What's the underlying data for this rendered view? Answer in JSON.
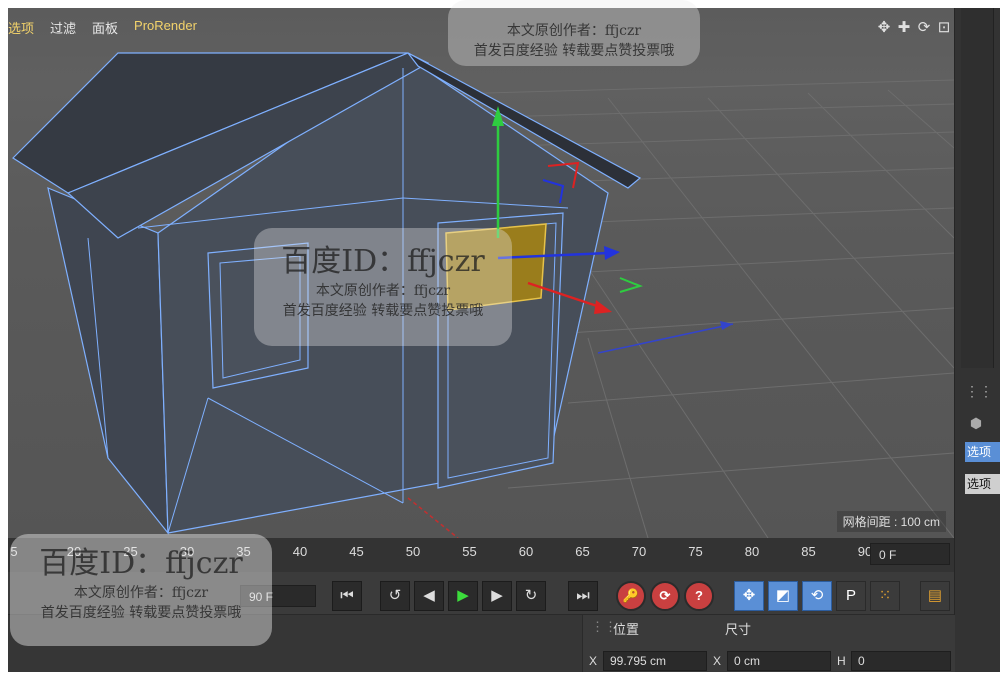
{
  "viewport": {
    "menu": [
      "选项",
      "过滤",
      "面板",
      "ProRender"
    ],
    "nav_icons": [
      "move-view-icon",
      "zoom-view-icon",
      "rotate-view-icon",
      "maximize-view-icon"
    ],
    "nav_glyphs": [
      "✥",
      "✚",
      "⟳",
      "⊡"
    ],
    "grid_spacing": "网格间距 : 100 cm"
  },
  "timeline": {
    "ticks": [
      "5",
      "20",
      "25",
      "30",
      "35",
      "40",
      "45",
      "50",
      "55",
      "60",
      "65",
      "70",
      "75",
      "80",
      "85",
      "90"
    ],
    "current_frame": "0 F"
  },
  "transport": {
    "end_frame": "90 F",
    "buttons": [
      {
        "name": "go-to-start-button",
        "glyph": "⏮"
      },
      {
        "name": "previous-key-button",
        "glyph": "↺"
      },
      {
        "name": "previous-frame-button",
        "glyph": "◀"
      },
      {
        "name": "play-button",
        "glyph": "▶"
      },
      {
        "name": "next-frame-button",
        "glyph": "▶"
      },
      {
        "name": "next-key-button",
        "glyph": "↻"
      },
      {
        "name": "go-to-end-button",
        "glyph": "⏭"
      }
    ],
    "record_buttons": [
      "🔑",
      "⟳",
      "?"
    ]
  },
  "coords": {
    "position_label": "位置",
    "size_label": "尺寸",
    "x_label": "X",
    "x_value": "99.795 cm",
    "x2_label": "X",
    "x2_value": "0 cm",
    "h_label": "H",
    "h_value": "0"
  },
  "right_strip": {
    "tab_active": "选项",
    "tab_normal": "选项"
  },
  "watermark": {
    "id": "百度ID：ffjczr",
    "author": "本文原创作者：ffjczr",
    "note": "首发百度经验  转载要点赞投票哦"
  },
  "colors": {
    "viewport_bg": "#5a5a5a",
    "wireframe": "#7fb0ff",
    "selection": "#b8941e",
    "active_tool": "#5a8fd6",
    "record_red": "#c94040"
  }
}
